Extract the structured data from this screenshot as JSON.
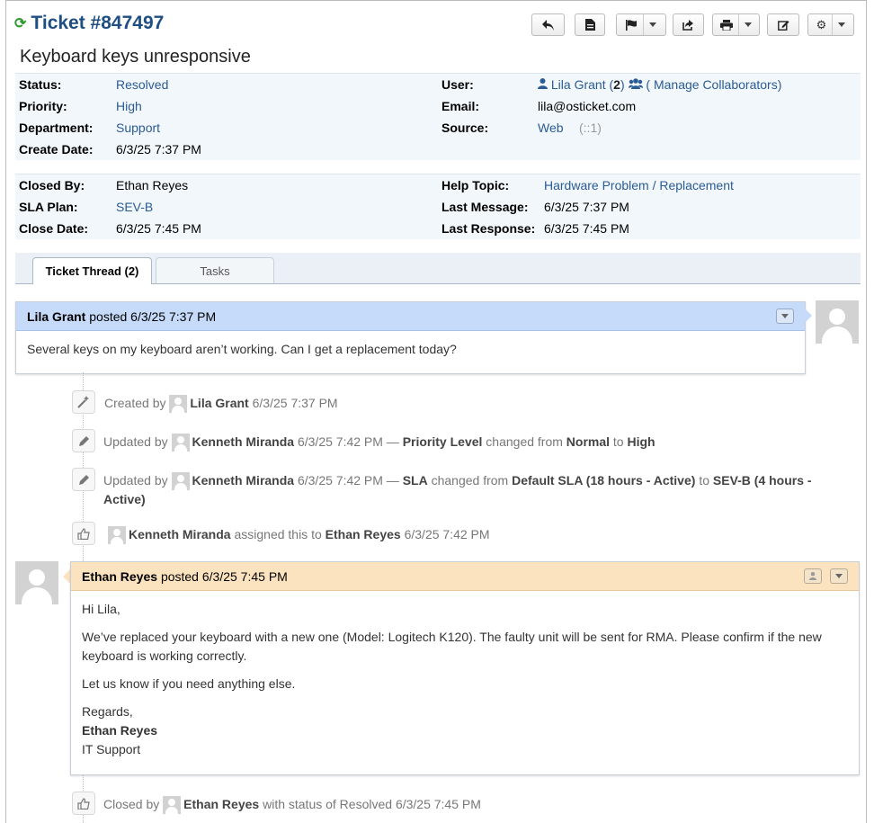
{
  "ticket": {
    "title": "Ticket #847497",
    "subject": "Keyboard keys unresponsive"
  },
  "info1": {
    "status_label": "Status:",
    "status": "Resolved",
    "priority_label": "Priority:",
    "priority": "High",
    "department_label": "Department:",
    "department": "Support",
    "create_label": "Create Date:",
    "create": "6/3/25 7:37 PM",
    "user_label": "User:",
    "user": "Lila Grant",
    "user_count_open": "(",
    "user_count": "2",
    "user_count_close": ")",
    "collab": "( Manage Collaborators)",
    "email_label": "Email:",
    "email": "lila@osticket.com",
    "source_label": "Source:",
    "source": "Web",
    "source_ip": "(::1)"
  },
  "info2": {
    "closed_by_label": "Closed By:",
    "closed_by": "Ethan Reyes",
    "sla_label": "SLA Plan:",
    "sla": "SEV-B",
    "close_date_label": "Close Date:",
    "close_date": "6/3/25 7:45 PM",
    "help_topic_label": "Help Topic:",
    "help_topic": "Hardware Problem / Replacement",
    "last_message_label": "Last Message:",
    "last_message": "6/3/25 7:37 PM",
    "last_response_label": "Last Response:",
    "last_response": "6/3/25 7:45 PM"
  },
  "tabs": {
    "thread": "Ticket Thread (2)",
    "tasks": "Tasks"
  },
  "message1": {
    "author": "Lila Grant",
    "posted": "posted 6/3/25 7:37 PM",
    "body": "Several keys on my keyboard aren’t working. Can I get a replacement today?"
  },
  "events": {
    "e1": {
      "prefix": "Created by",
      "who": "Lila Grant",
      "time": "6/3/25 7:37 PM"
    },
    "e2": {
      "prefix": "Updated by",
      "who": "Kenneth Miranda",
      "time": "6/3/25 7:42 PM —",
      "field": "Priority Level",
      "mid": "changed from",
      "from": "Normal",
      "to_word": "to",
      "to": "High"
    },
    "e3": {
      "prefix": "Updated by",
      "who": "Kenneth Miranda",
      "time": "6/3/25 7:42 PM —",
      "field": "SLA",
      "mid": "changed from",
      "from": "Default SLA (18 hours - Active)",
      "to_word": "to",
      "to": "SEV-B (4 hours - Active)"
    },
    "e4": {
      "who": "Kenneth Miranda",
      "mid": "assigned this to",
      "to": "Ethan Reyes",
      "time": "6/3/25 7:42 PM"
    },
    "e5": {
      "prefix": "Closed by",
      "who": "Ethan Reyes",
      "mid": "with status of Resolved 6/3/25 7:45 PM"
    }
  },
  "message2": {
    "author": "Ethan Reyes",
    "posted": "posted 6/3/25 7:45 PM",
    "greeting": "Hi Lila,",
    "p1": "We’ve replaced your keyboard with a new one (Model: Logitech K120). The faulty unit will be sent for RMA. Please confirm if the new keyboard is working correctly.",
    "p2": "Let us know if you need anything else.",
    "sig1": "Regards,",
    "sig2": "Ethan Reyes",
    "sig3": "IT Support"
  },
  "colors": {
    "accent": "#1f4f82",
    "link": "#2a5b94",
    "user_header": "#c6dbf9",
    "staff_header": "#fce3bf"
  },
  "icons": [
    "refresh-icon",
    "reply-icon",
    "note-icon",
    "flag-icon",
    "share-icon",
    "print-icon",
    "edit-icon",
    "gear-icon",
    "user-icon",
    "collaborators-icon",
    "chevron-down-icon",
    "magic-wand-icon",
    "pencil-icon",
    "thumbs-up-icon"
  ]
}
